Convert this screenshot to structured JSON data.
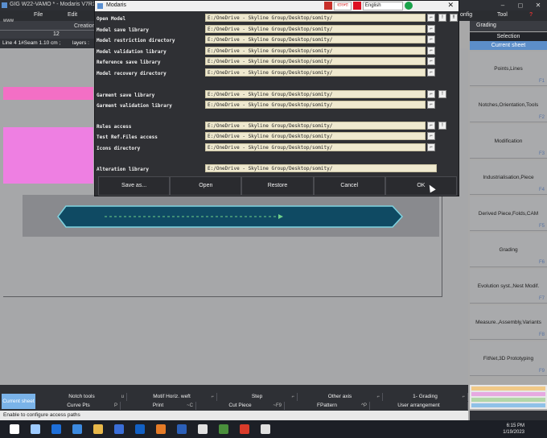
{
  "app": {
    "title": "GIG W22-VAMO * - Modaris V7R1",
    "window_buttons": [
      "–",
      "◻",
      "✕"
    ]
  },
  "menubar": {
    "file": "File",
    "edit": "Edit",
    "config": "onfig",
    "tool": "Tool",
    "www": "www",
    "creation": "Creation",
    "number": "12"
  },
  "linebar": {
    "line_info": "Line 4 1#Seam 1.10 cm ;",
    "layers": "layers :"
  },
  "right_panel": {
    "header": "Grading",
    "selection": "Selection",
    "current_sheet": "Current sheet",
    "items": [
      {
        "label": "Points,Lines",
        "key": "F1"
      },
      {
        "label": "Notches,Orientation,Tools",
        "key": "F2"
      },
      {
        "label": "Modification",
        "key": "F3"
      },
      {
        "label": "Industrialisation,Piece",
        "key": "F4"
      },
      {
        "label": "Derived Piece,Folds,CAM",
        "key": "F5"
      },
      {
        "label": "Grading",
        "key": "F6"
      },
      {
        "label": "Evolution syst.,Nest Modif.",
        "key": "F7"
      },
      {
        "label": "Measure.,Assembly,Variants",
        "key": "F8"
      },
      {
        "label": "FitNet,3D Prototyping",
        "key": "F9"
      }
    ],
    "swatch_colors": [
      "#f0c987",
      "#e6a9e1",
      "#b2d6a8",
      "#8fc1e8"
    ]
  },
  "bottom_tools": {
    "current_sheet": "Current sheet",
    "row1": [
      {
        "label": "Notch tools",
        "key": "u"
      },
      {
        "label": "Motif Horiz. weft",
        "key": "⌐"
      },
      {
        "label": "Step",
        "key": "⌐"
      },
      {
        "label": "Other axis",
        "key": "⌐"
      },
      {
        "label": "1- Grading",
        "key": "⌐"
      }
    ],
    "row2": [
      {
        "label": "Curve Pts",
        "key": "P"
      },
      {
        "label": "Print",
        "key": "~C"
      },
      {
        "label": "Cut Piece",
        "key": "~F9"
      },
      {
        "label": "FPattern",
        "key": "^P"
      },
      {
        "label": "User arrangement",
        "key": ""
      }
    ]
  },
  "status": {
    "message": "Enable to configure access paths"
  },
  "taskbar": {
    "time": "6:15 PM",
    "date": "1/19/2023",
    "icon_colors": [
      "#ffffff",
      "#9ecbff",
      "#1e6fd9",
      "#3c8ae0",
      "#e8b84a",
      "#3a6ed8",
      "#1260c4",
      "#e57b27",
      "#2b5fb8",
      "#e1e1e1",
      "#4a8f3c",
      "#d83b2a",
      "#e0e0e0"
    ]
  },
  "dialog": {
    "title": "Modaris",
    "close": "✕",
    "ime": {
      "label1": "বাংলা",
      "language": "English"
    },
    "rows": [
      {
        "label": "Open Model",
        "path": "E:/OneDrive - Skyline Group/Desktop/somity/",
        "buttons": [
          "⌐",
          "!",
          "!!"
        ]
      },
      {
        "label": "Model save library",
        "path": "E:/OneDrive - Skyline Group/Desktop/somity/",
        "buttons": [
          "⌐"
        ]
      },
      {
        "label": "Model restriction directory",
        "path": "E:/OneDrive - Skyline Group/Desktop/somity/",
        "buttons": [
          "⌐"
        ]
      },
      {
        "label": "Model validation library",
        "path": "E:/OneDrive - Skyline Group/Desktop/somity/",
        "buttons": [
          "⌐"
        ]
      },
      {
        "label": "Reference save library",
        "path": "E:/OneDrive - Skyline Group/Desktop/somity/",
        "buttons": [
          "⌐"
        ]
      },
      {
        "label": "Model recovery directory",
        "path": "E:/OneDrive - Skyline Group/Desktop/somity/",
        "buttons": [
          "⌐"
        ]
      },
      {
        "label": "Garment save  library",
        "path": "E:/OneDrive - Skyline Group/Desktop/somity/",
        "buttons": [
          "⌐",
          "!"
        ]
      },
      {
        "label": "Garment validation library",
        "path": "E:/OneDrive - Skyline Group/Desktop/somity/",
        "buttons": [
          "⌐"
        ]
      },
      {
        "label": "Rules access",
        "path": "E:/OneDrive - Skyline Group/Desktop/somity/",
        "buttons": [
          "⌐",
          "!"
        ]
      },
      {
        "label": "Test Ref.Files access",
        "path": "E:/OneDrive - Skyline Group/Desktop/somity/",
        "buttons": [
          "⌐"
        ]
      },
      {
        "label": "Icons directory",
        "path": "E:/OneDrive - Skyline Group/Desktop/somity/",
        "buttons": [
          "⌐"
        ]
      },
      {
        "label": "Alteration library",
        "path": "E:/OneDrive - Skyline Group/Desktop/somity/",
        "buttons": []
      }
    ],
    "footer": [
      "Save as...",
      "Open",
      "Restore",
      "Cancel",
      "OK"
    ]
  }
}
